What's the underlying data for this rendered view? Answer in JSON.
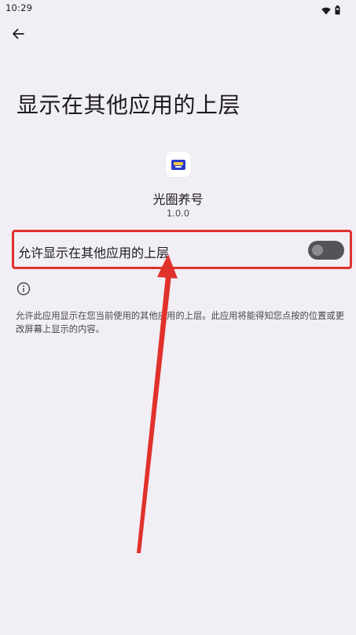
{
  "status_bar": {
    "time": "10:29",
    "icons": [
      "wifi-icon",
      "battery-icon"
    ]
  },
  "toolbar": {
    "back_icon": "arrow-left-icon"
  },
  "page": {
    "title": "显示在其他应用的上层"
  },
  "app": {
    "name": "光圈养号",
    "version": "1.0.0"
  },
  "setting": {
    "label": "允许显示在其他应用的上层",
    "enabled": false
  },
  "info": {
    "icon": "info-icon",
    "description": "允许此应用显示在您当前使用的其他应用的上层。此应用将能得知您点按的位置或更改屏幕上显示的内容。"
  },
  "colors": {
    "background": "#f2eef5",
    "annotation": "#e0312b",
    "switch_track": "#56525a",
    "app_icon_accent": "#2b3cc9"
  }
}
